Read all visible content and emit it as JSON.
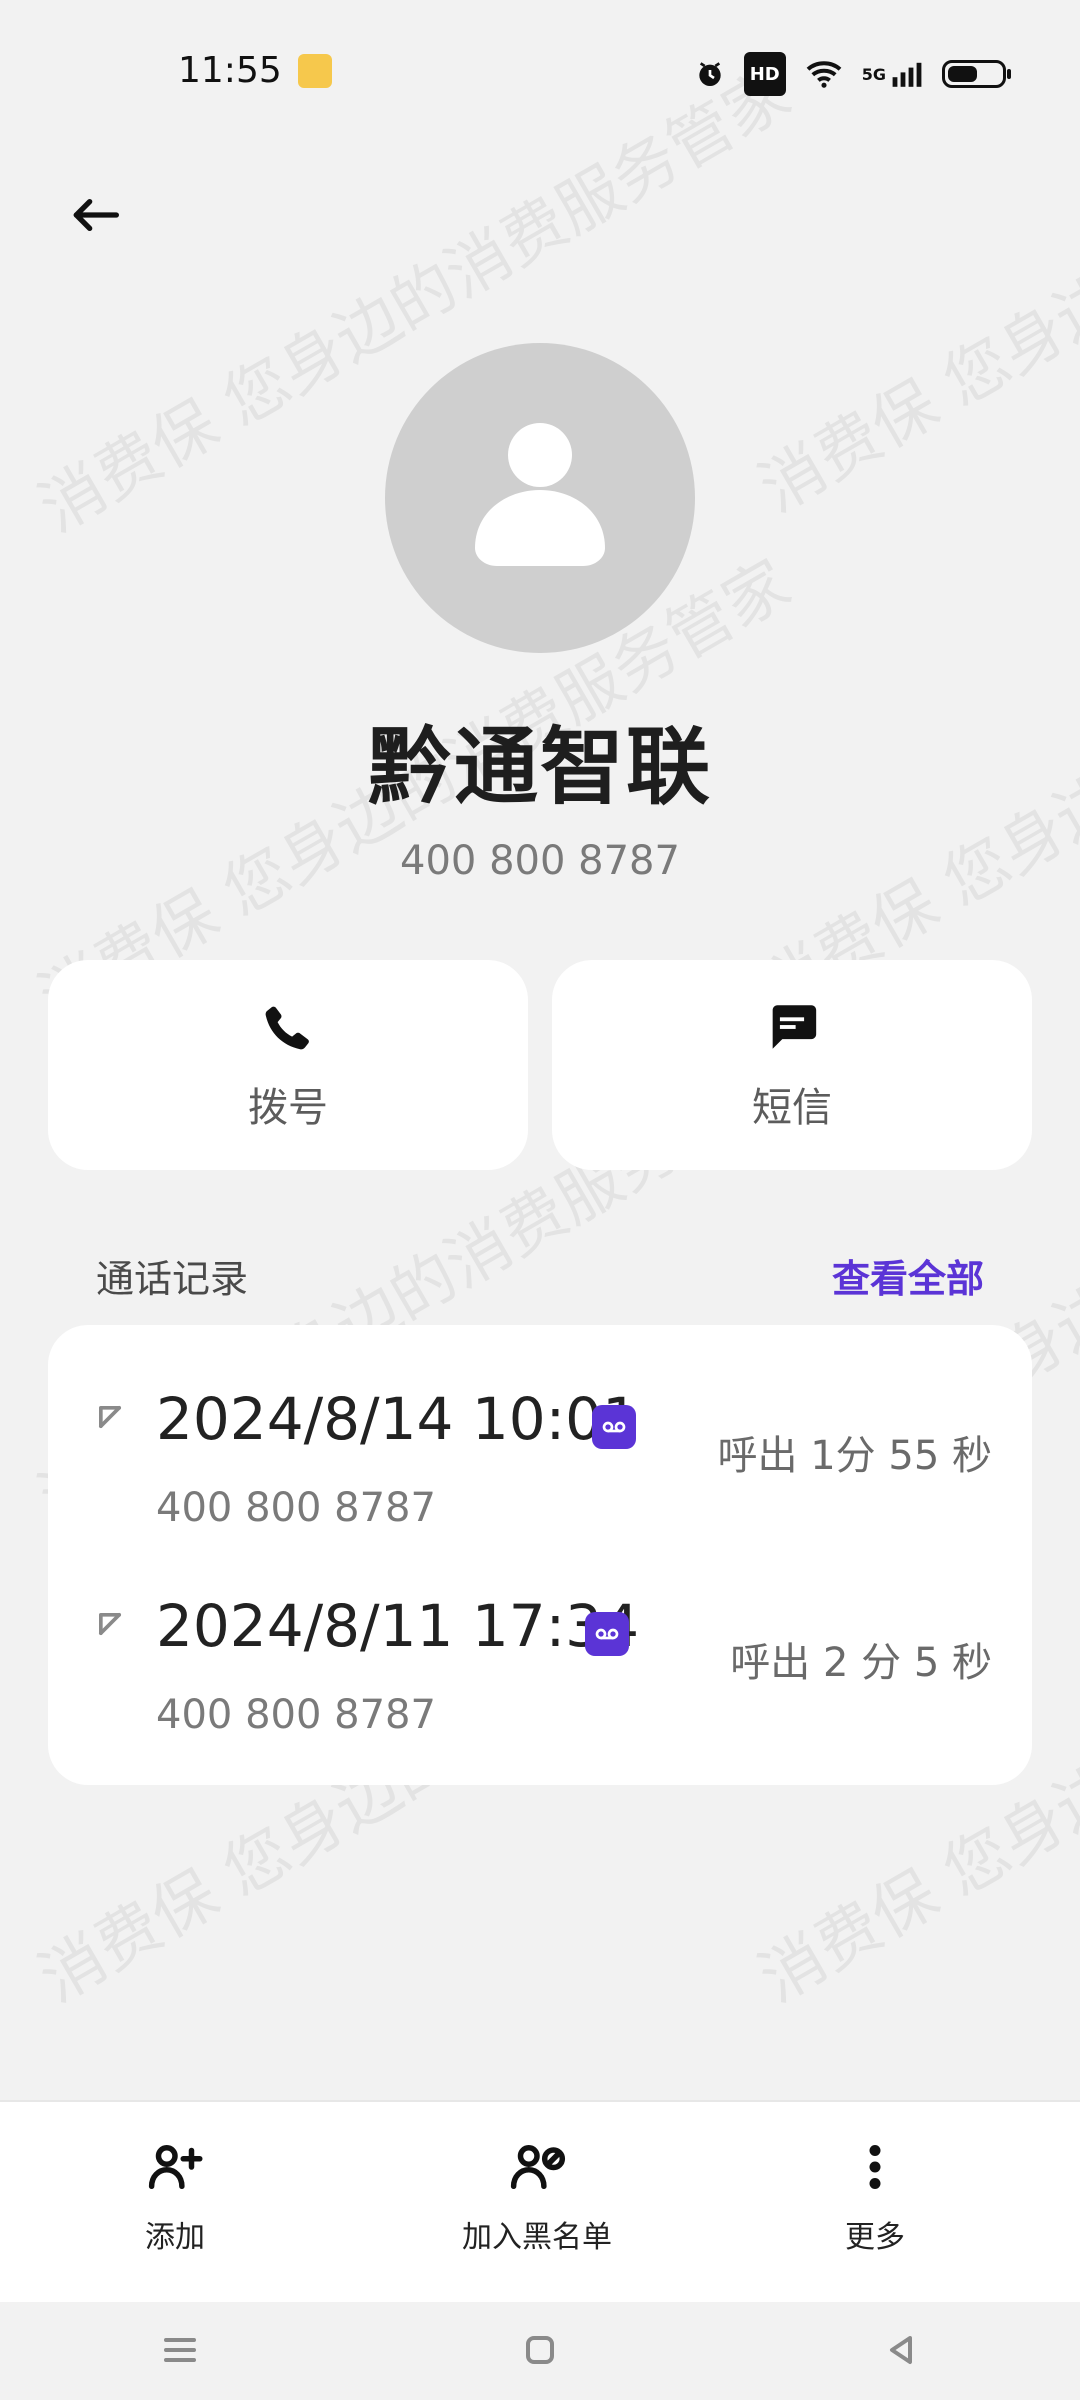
{
  "status_bar": {
    "time": "11:55",
    "hd": "HD",
    "network": "5G",
    "battery_level": 0.6
  },
  "contact": {
    "name": "黔通智联",
    "phone": "400 800 8787"
  },
  "actions": {
    "dial_label": "拨号",
    "sms_label": "短信"
  },
  "call_log": {
    "title": "通话记录",
    "view_all": "查看全部",
    "rows": [
      {
        "datetime": "2024/8/14 10:01",
        "number": "400 800 8787",
        "duration": "呼出 1分 55 秒"
      },
      {
        "datetime": "2024/8/11 17:34",
        "number": "400 800 8787",
        "duration": "呼出 2 分 5 秒"
      }
    ]
  },
  "bottom_actions": {
    "add": "添加",
    "blacklist": "加入黑名单",
    "more": "更多"
  },
  "watermark": {
    "line_1": "消费保 您身边的消费服务管家",
    "line_2": "消费保 您身边"
  },
  "colors": {
    "accent": "#5b34d6",
    "background": "#f2f2f2",
    "card": "#ffffff"
  }
}
